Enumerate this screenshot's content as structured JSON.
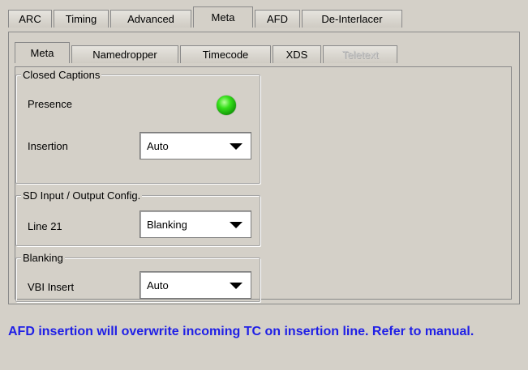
{
  "top_tabs": [
    {
      "label": "ARC"
    },
    {
      "label": "Timing"
    },
    {
      "label": "Advanced"
    },
    {
      "label": "Meta"
    },
    {
      "label": "AFD"
    },
    {
      "label": "De-Interlacer"
    }
  ],
  "active_top_tab": "Meta",
  "sub_tabs": [
    {
      "label": "Meta"
    },
    {
      "label": "Namedropper"
    },
    {
      "label": "Timecode"
    },
    {
      "label": "XDS"
    },
    {
      "label": "Teletext"
    }
  ],
  "active_sub_tab": "Meta",
  "disabled_sub_tabs": [
    "Teletext"
  ],
  "closed_captions": {
    "title": "Closed Captions",
    "presence_label": "Presence",
    "presence_status_color": "#2fd81a",
    "insertion_label": "Insertion",
    "insertion_value": "Auto"
  },
  "sd_config": {
    "title": "SD Input / Output Config.",
    "line21_label": "Line 21",
    "line21_value": "Blanking"
  },
  "blanking": {
    "title": "Blanking",
    "vbi_label": "VBI Insert",
    "vbi_value": "Auto"
  },
  "message": "AFD insertion will overwrite incoming TC on insertion line. Refer to manual.",
  "colors": {
    "background": "#d4d0c8",
    "message_text": "#1f1fe6"
  }
}
